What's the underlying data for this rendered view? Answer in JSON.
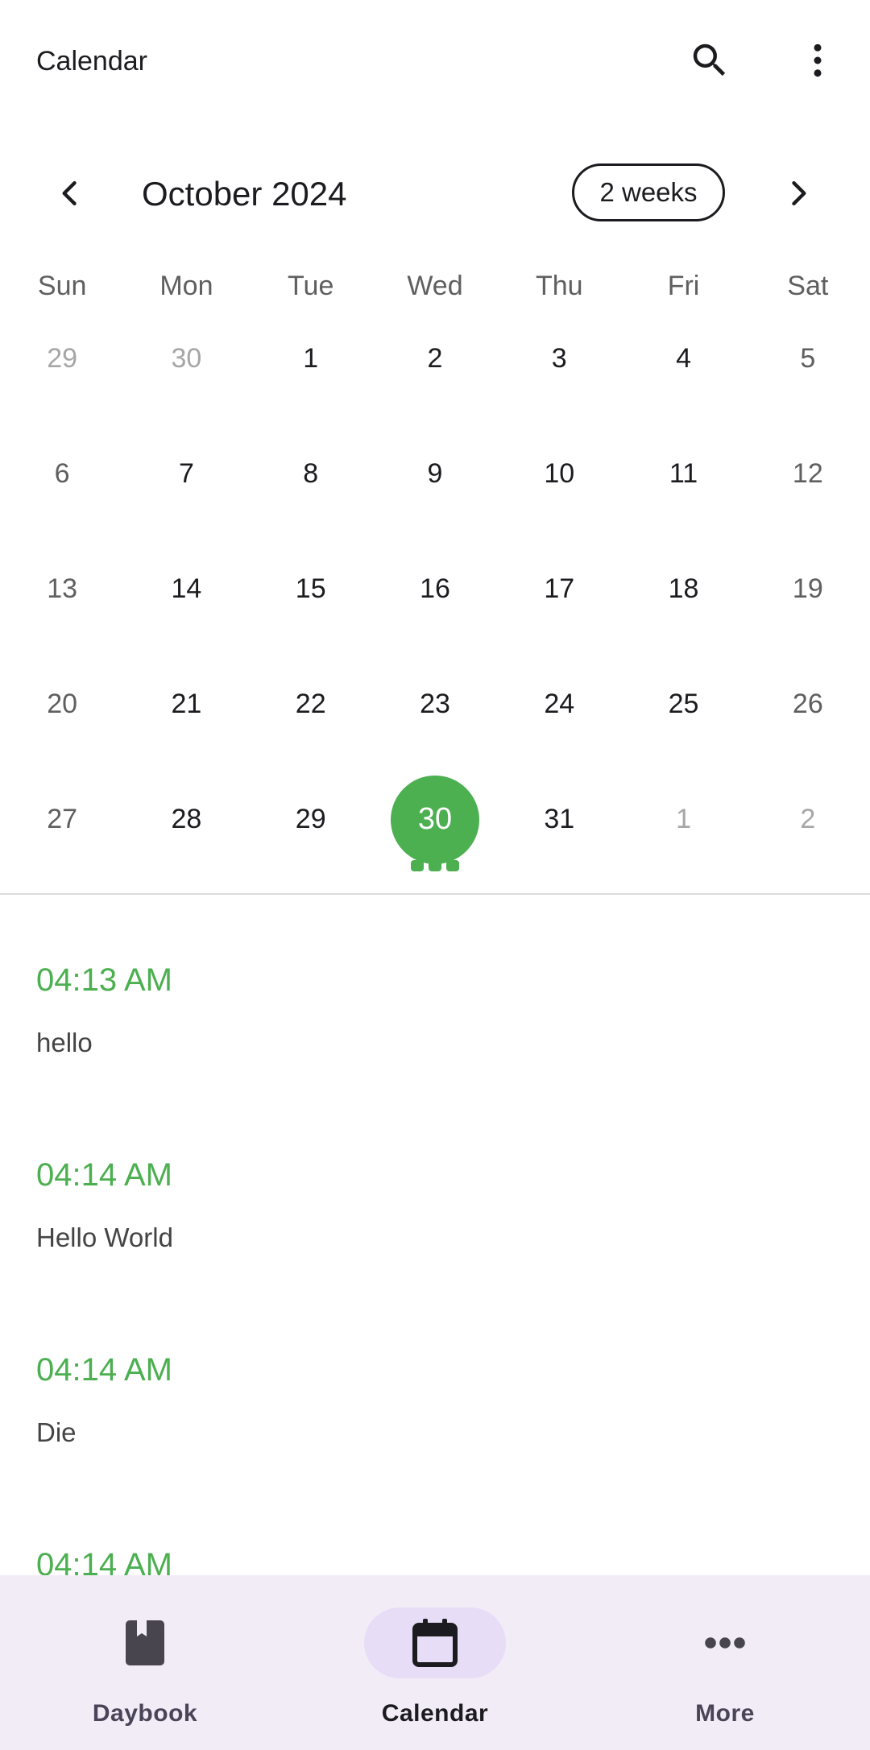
{
  "app_bar": {
    "title": "Calendar",
    "icons": [
      "search-icon",
      "more-vert-icon"
    ]
  },
  "calendar": {
    "month_title": "October 2024",
    "format_chip": "2 weeks",
    "weekdays": [
      "Sun",
      "Mon",
      "Tue",
      "Wed",
      "Thu",
      "Fri",
      "Sat"
    ],
    "selected_day": "30",
    "selected_color": "#4caf50",
    "weeks": [
      [
        {
          "n": "29",
          "out": true
        },
        {
          "n": "30",
          "out": true
        },
        {
          "n": "1"
        },
        {
          "n": "2"
        },
        {
          "n": "3"
        },
        {
          "n": "4"
        },
        {
          "n": "5"
        }
      ],
      [
        {
          "n": "6"
        },
        {
          "n": "7"
        },
        {
          "n": "8"
        },
        {
          "n": "9"
        },
        {
          "n": "10"
        },
        {
          "n": "11"
        },
        {
          "n": "12"
        }
      ],
      [
        {
          "n": "13"
        },
        {
          "n": "14"
        },
        {
          "n": "15"
        },
        {
          "n": "16"
        },
        {
          "n": "17"
        },
        {
          "n": "18"
        },
        {
          "n": "19"
        }
      ],
      [
        {
          "n": "20"
        },
        {
          "n": "21"
        },
        {
          "n": "22"
        },
        {
          "n": "23"
        },
        {
          "n": "24"
        },
        {
          "n": "25"
        },
        {
          "n": "26"
        }
      ],
      [
        {
          "n": "27"
        },
        {
          "n": "28"
        },
        {
          "n": "29"
        },
        {
          "n": "30",
          "selected": true,
          "markers": 3
        },
        {
          "n": "31"
        },
        {
          "n": "1",
          "out": true
        },
        {
          "n": "2",
          "out": true
        }
      ]
    ]
  },
  "entries": [
    {
      "time": "04:13 AM",
      "text": "hello"
    },
    {
      "time": "04:14 AM",
      "text": "Hello World"
    },
    {
      "time": "04:14 AM",
      "text": "Die"
    },
    {
      "time": "04:14 AM",
      "text": ""
    }
  ],
  "bottom_nav": {
    "items": [
      {
        "label": "Daybook",
        "icon": "book-icon",
        "active": false
      },
      {
        "label": "Calendar",
        "icon": "calendar-icon",
        "active": true
      },
      {
        "label": "More",
        "icon": "more-horiz-icon",
        "active": false
      }
    ],
    "background": "#f2ecf7",
    "active_indicator": "#e7ddf7"
  }
}
